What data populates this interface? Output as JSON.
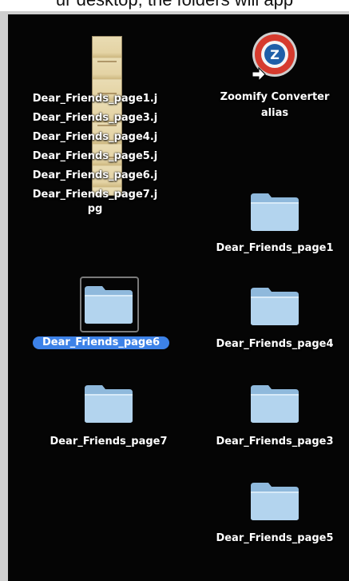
{
  "caption": "ur desktop, the folders will app",
  "desktop": {
    "stacked_files": [
      "Dear_Friends_page1.j",
      "Dear_Friends_page3.j",
      "Dear_Friends_page4.j",
      "Dear_Friends_page5.j",
      "Dear_Friends_page6.j",
      "Dear_Friends_page7.j",
      "pg"
    ],
    "alias": {
      "line1": "Zoomify Converter",
      "line2": "alias",
      "icon": "zoomify-alias-icon"
    },
    "folders": {
      "page1": "Dear_Friends_page1",
      "page6": "Dear_Friends_page6",
      "page4": "Dear_Friends_page4",
      "page7": "Dear_Friends_page7",
      "page3": "Dear_Friends_page3",
      "page5": "Dear_Friends_page5"
    },
    "selected_folder": "page6",
    "colors": {
      "background": "#050505",
      "selection": "#3d82e8",
      "folder": "#a9cdea"
    }
  }
}
